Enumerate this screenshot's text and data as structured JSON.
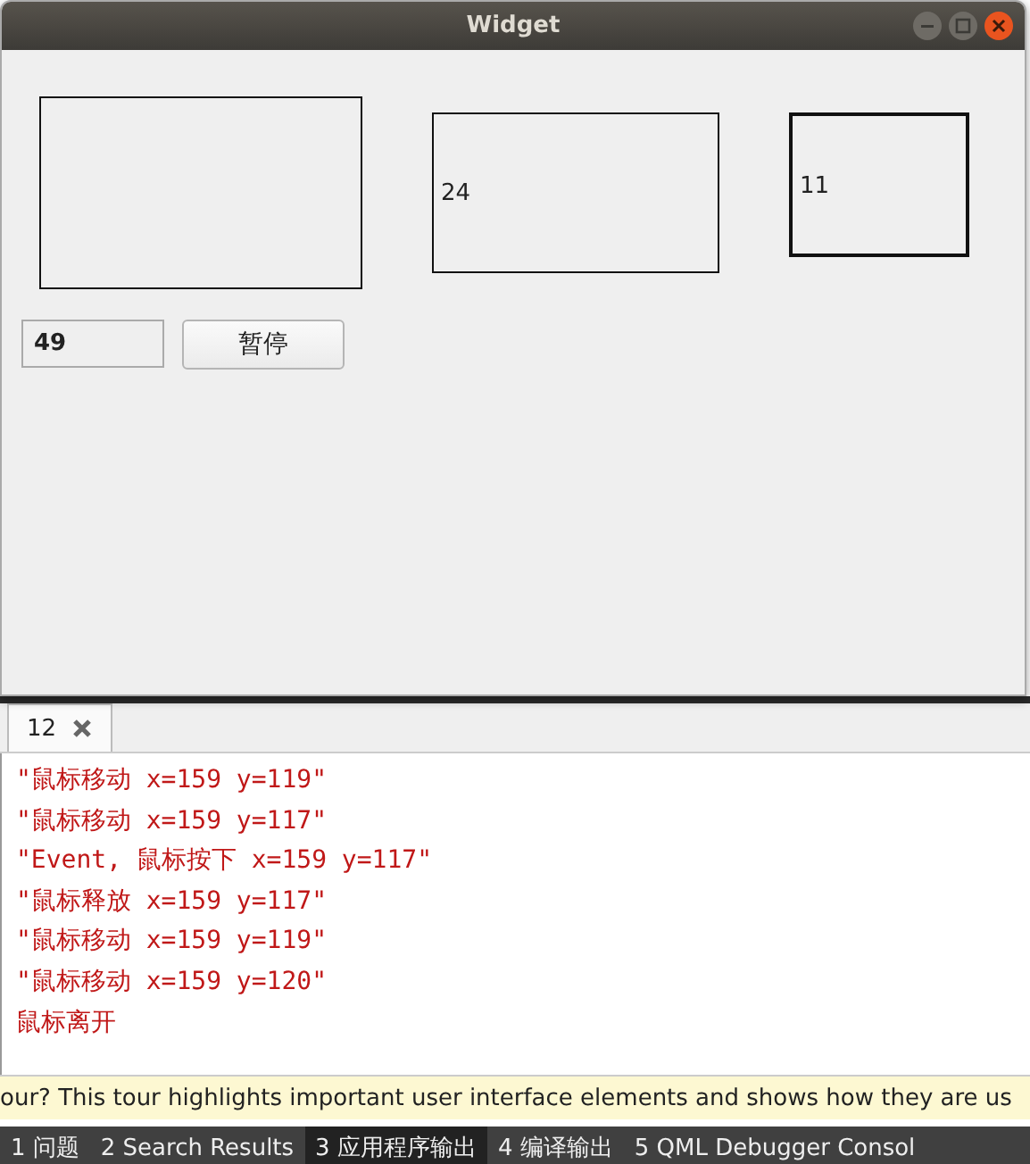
{
  "window": {
    "title": "Widget"
  },
  "labels": [
    {
      "thick": false
    },
    {
      "thick": false,
      "text": "24"
    },
    {
      "thick": true,
      "text": "11"
    }
  ],
  "counter_field": {
    "value": "49"
  },
  "pause_button": {
    "label": "暂停"
  },
  "output_tabs": [
    {
      "label": "12"
    }
  ],
  "output_lines": [
    "\"鼠标移动 x=159 y=119\"",
    "\"鼠标移动 x=159 y=117\"",
    "\"Event, 鼠标按下 x=159 y=117\"",
    "\"鼠标释放 x=159 y=117\"",
    "\"鼠标移动 x=159 y=119\"",
    "\"鼠标移动 x=159 y=120\"",
    "鼠标离开"
  ],
  "info_bar": "our? This tour highlights important user interface elements and shows how they are us",
  "bottom_tabs": [
    {
      "label": "1 问题",
      "selected": false
    },
    {
      "label": "2 Search Results",
      "selected": false
    },
    {
      "label": "3 应用程序输出",
      "selected": true
    },
    {
      "label": "4 编译输出",
      "selected": false
    },
    {
      "label": "5 QML Debugger Consol",
      "selected": false
    }
  ]
}
